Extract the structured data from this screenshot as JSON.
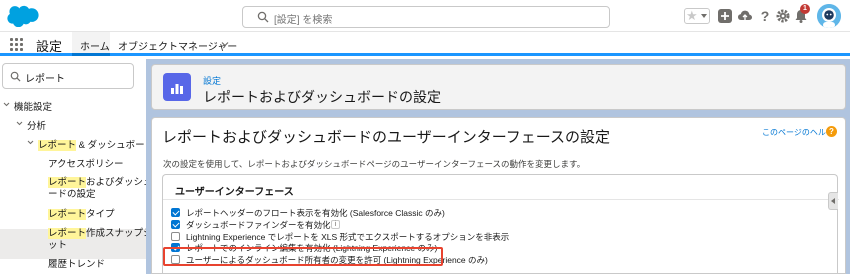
{
  "header": {
    "search_placeholder": "[設定] を検索",
    "notification_count": "1"
  },
  "nav": {
    "app_name": "設定",
    "tab_home": "ホーム",
    "tab_object_manager": "オブジェクトマネージャー"
  },
  "sidebar": {
    "quick_find_value": "レポート",
    "items": [
      {
        "label": "機能設定"
      },
      {
        "label": "分析"
      },
      {
        "label_hl": "レポート",
        "label_rest": " & ダッシュボード"
      },
      {
        "label": "アクセスポリシー"
      },
      {
        "label_hl": "レポート",
        "label_rest": "およびダッシュボ",
        "line2": "ードの設定"
      },
      {
        "label_hl": "レポート",
        "label_rest": "タイプ"
      },
      {
        "label_hl": "レポート",
        "label_rest": "作成スナップショ",
        "line2": "ット"
      },
      {
        "label": "履歴トレンド"
      }
    ]
  },
  "page_header": {
    "breadcrumb": "設定",
    "title": "レポートおよびダッシュボードの設定"
  },
  "content": {
    "title": "レポートおよびダッシュボードのユーザーインターフェースの設定",
    "help_link": "このページのヘルプ",
    "description": "次の設定を使用して、レポートおよびダッシュボードページのユーザーインターフェースの動作を変更します。",
    "section_title": "ユーザーインターフェース",
    "options": [
      {
        "label": "レポートヘッダーのフロート表示を有効化 (Salesforce Classic のみ)",
        "checked": true
      },
      {
        "label": "ダッシュボードファインダーを有効化",
        "checked": true,
        "info": "i"
      },
      {
        "label": "Lightning Experience でレポートを XLS 形式でエクスポートするオプションを非表示",
        "checked": false
      },
      {
        "label": "レポートでのインライン編集を有効化 (Lightning Experience のみ)",
        "checked": true
      },
      {
        "label": "ユーザーによるダッシュボード所有者の変更を許可 (Lightning Experience のみ)",
        "checked": false
      }
    ]
  },
  "colors": {
    "brand": "#0176d3",
    "highlight": "#fff59a",
    "callout": "#e8432f"
  }
}
